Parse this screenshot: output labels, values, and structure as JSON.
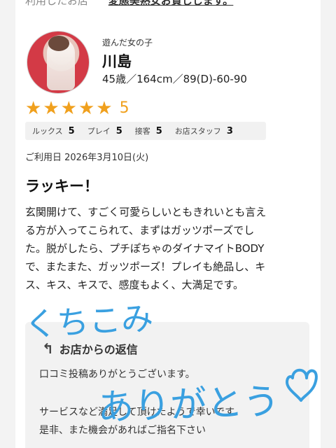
{
  "top": {
    "left_text": "利用したお店",
    "link_text": "変態美熟女お貸しします。"
  },
  "profile": {
    "label": "遊んだ女の子",
    "name": "川島",
    "specs": "45歳／164cm／89(D)-60-90"
  },
  "rating": {
    "stars_filled": 5,
    "stars_total": 5,
    "score": "5",
    "star_color": "#f0a01d"
  },
  "subscores": [
    {
      "label": "ルックス",
      "value": "5"
    },
    {
      "label": "プレイ",
      "value": "5"
    },
    {
      "label": "接客",
      "value": "5"
    },
    {
      "label": "お店スタッフ",
      "value": "3"
    }
  ],
  "review": {
    "date": "ご利用日 2026年3月10日(火)",
    "title": "ラッキー！",
    "lines": [
      "玄関開けて、すごく可愛らしいともきれいとも言え",
      "る方が入ってこられて、まずはガッツポーズでし",
      "た。脱がしたら、プチぽちゃのダイナマイトBODY",
      "で、またまた、ガッツポーズ！プレイも絶品し、キ",
      "ス、キス、キスで、感度もよく、大満足です。"
    ]
  },
  "reply": {
    "icon": "reply-arrow-icon",
    "heading": "お店からの返信",
    "lines": [
      "口コミ投稿ありがとうございます。",
      "",
      "サービスなど満足して頂けたようで幸いです",
      "是非、また機会があればご指名下さい"
    ]
  },
  "handwriting": {
    "line1": "くちこみ",
    "line2": "ありがとう",
    "heart_icon": "heart-icon",
    "ink_color": "#3aa0e0"
  }
}
